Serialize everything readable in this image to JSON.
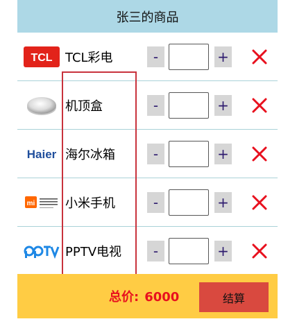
{
  "header": {
    "title": "张三的商品"
  },
  "items": [
    {
      "name": "TCL彩电",
      "logo": "tcl-logo",
      "quantity": "",
      "minus": "-",
      "plus": "+"
    },
    {
      "name": "机顶盒",
      "logo": "set-top-box-image",
      "quantity": "",
      "minus": "-",
      "plus": "+"
    },
    {
      "name": "海尔冰箱",
      "logo": "haier-logo",
      "quantity": "",
      "minus": "-",
      "plus": "+"
    },
    {
      "name": "小米手机",
      "logo": "xiaomi-logo",
      "quantity": "",
      "minus": "-",
      "plus": "+"
    },
    {
      "name": "PPTV电视",
      "logo": "pptv-logo",
      "quantity": "",
      "minus": "-",
      "plus": "+"
    }
  ],
  "footer": {
    "total_label": "总价:",
    "total_value": "6000",
    "checkout_label": "结算"
  },
  "colors": {
    "header_bg": "#add8e6",
    "footer_bg": "#ffcc44",
    "total_text": "#e8101e",
    "checkout_bg": "#d9493f",
    "remove_icon": "#e8101e",
    "highlight_border": "#c8323c"
  }
}
